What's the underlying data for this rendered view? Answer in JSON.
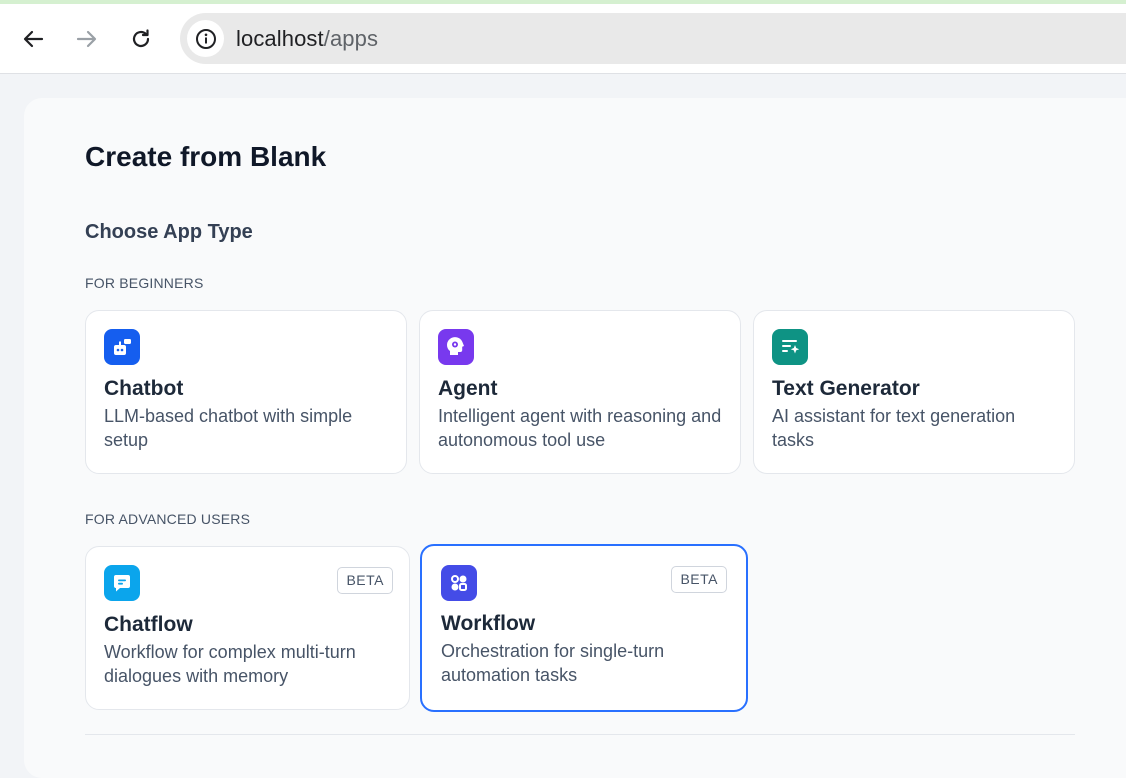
{
  "browser": {
    "url_host": "localhost",
    "url_path": "/apps"
  },
  "page": {
    "title": "Create from Blank",
    "subtitle": "Choose App Type",
    "group_beginners": "FOR BEGINNERS",
    "group_advanced": "FOR ADVANCED USERS"
  },
  "cards": {
    "chatbot": {
      "title": "Chatbot",
      "desc": "LLM-based chatbot with simple setup",
      "icon": "chatbot-icon",
      "color": "#155eef"
    },
    "agent": {
      "title": "Agent",
      "desc": "Intelligent agent with reasoning and autonomous tool use",
      "icon": "agent-icon",
      "color": "#7839ee"
    },
    "textgen": {
      "title": "Text Generator",
      "desc": "AI assistant for text generation tasks",
      "icon": "text-generator-icon",
      "color": "#0e9384"
    },
    "chatflow": {
      "title": "Chatflow",
      "desc": "Workflow for complex multi-turn dialogues with memory",
      "badge": "BETA",
      "icon": "chatflow-icon",
      "color": "#0ba5ec"
    },
    "workflow": {
      "title": "Workflow",
      "desc": "Orchestration for single-turn automation tasks",
      "badge": "BETA",
      "icon": "workflow-icon",
      "color": "#444ce7"
    }
  },
  "selected_card": "workflow"
}
